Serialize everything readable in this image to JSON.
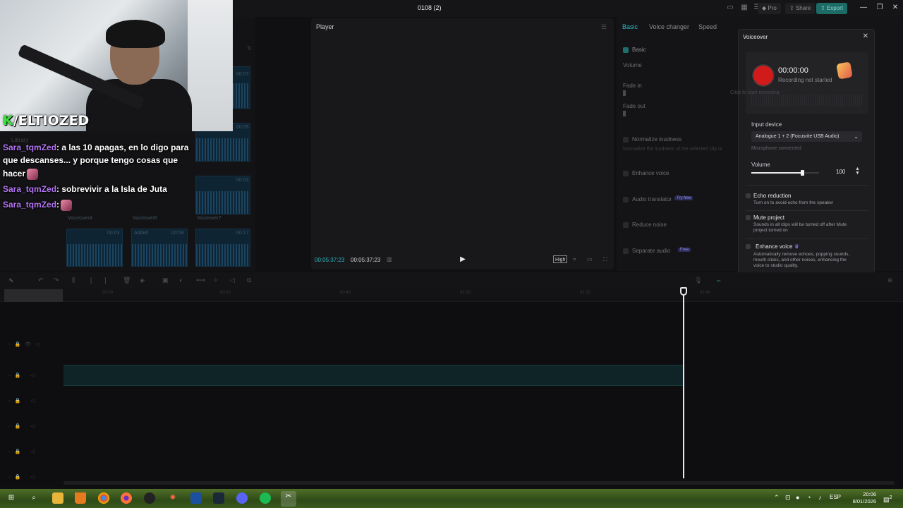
{
  "window": {
    "title": "0108 (2)",
    "pro_label": "Pro",
    "share_label": "Share",
    "export_label": "Export",
    "accent": "#2bb7c0"
  },
  "stream": {
    "logo_k": "K",
    "logo_rest": "/ELTIOZED",
    "chat": [
      {
        "user": "Sara_tqmZed",
        "text": ": a las 10 apagas, en lo digo para"
      },
      {
        "user": "",
        "text": "que descanses...  y porque tengo cosas que"
      },
      {
        "user": "",
        "text": "hacer"
      },
      {
        "user": "Sara_tqmZed",
        "text": ": sobrevivir a la Isla de Juta"
      },
      {
        "user": "Sara_tqmZed",
        "text": ":"
      }
    ]
  },
  "media": {
    "library_label": "Library",
    "clip_labels": [
      "Voiceover4",
      "Voiceover6",
      "Voiceover7",
      "00:03",
      "Added",
      "00:08",
      "00:17",
      "00:07",
      "00:05",
      "00:03"
    ]
  },
  "player": {
    "title": "Player",
    "current_time": "00:05:37:23",
    "total_time": "00:05:37:23",
    "quality_label": "High"
  },
  "inspector": {
    "tabs": [
      "Basic",
      "Voice changer",
      "Speed"
    ],
    "section": "Basic",
    "volume_label": "Volume",
    "fade_in": "Fade in",
    "fade_out": "Fade out",
    "normalize": "Normalize loudness",
    "normalize_sub": "Normalize the loudness of the selected clip or",
    "enhance": "Enhance voice",
    "translator": "Audio translator",
    "translator_badge": "Try free",
    "reduce_noise": "Reduce noise",
    "separate": "Separate audio",
    "separate_badge": "Free"
  },
  "voiceover": {
    "title": "Voiceover",
    "time": "00:00:00",
    "status": "Recording not started",
    "tooltip": "Click to start recording",
    "input_device_label": "Input device",
    "input_device_value": "Analogue 1 + 2 (Focusrite USB Audio)",
    "mic_status": "Microphone connected",
    "volume_label": "Volume",
    "volume_value": "100",
    "volume_level": 0.75,
    "options": [
      {
        "title": "Echo reduction",
        "desc": "Turn on to avoid echo from the speaker"
      },
      {
        "title": "Mute project",
        "desc": "Sounds in all clips will be turned off after Mute project turned on"
      },
      {
        "title": "Enhance voice",
        "desc": "Automatically remove echoes, popping sounds, mouth clicks, and other noises, enhancing the voice to studio quality."
      }
    ],
    "record_color": "#d11a1a"
  },
  "timeline": {
    "ruler_marks": [
      "00:00",
      "00:20",
      "00:40",
      "01:00",
      "01:20",
      "01:40"
    ]
  },
  "taskbar": {
    "language": "ESP",
    "time": "20:06",
    "date": "8/01/2026",
    "notification_count": "2"
  }
}
